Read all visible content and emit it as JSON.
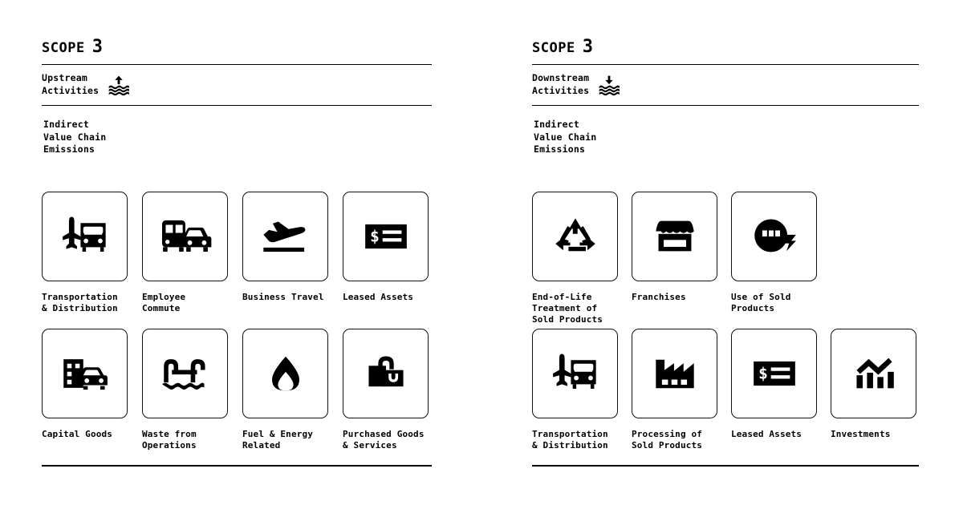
{
  "panels": [
    {
      "id": "upstream",
      "scope_word": "SCOPE",
      "scope_number": "3",
      "stream_label": "Upstream\nActivities",
      "stream_icon": "arrow-up-over-waves-icon",
      "emissions_note": "Indirect\nValue Chain\nEmissions",
      "rows": [
        {
          "cards": [
            {
              "label": "Transportation\n& Distribution",
              "icon": "plane-truck-icon"
            },
            {
              "label": "Employee\nCommute",
              "icon": "bus-car-icon"
            },
            {
              "label": "Business Travel",
              "icon": "plane-takeoff-icon"
            },
            {
              "label": "Leased Assets",
              "icon": "dollar-card-icon"
            }
          ]
        },
        {
          "cards": [
            {
              "label": "Capital Goods",
              "icon": "building-car-icon"
            },
            {
              "label": "Waste from\nOperations",
              "icon": "waste-water-icon"
            },
            {
              "label": "Fuel & Energy\nRelated",
              "icon": "droplet-icon"
            },
            {
              "label": "Purchased Goods\n& Services",
              "icon": "shopping-bag-icon"
            }
          ]
        }
      ]
    },
    {
      "id": "downstream",
      "scope_word": "SCOPE",
      "scope_number": "3",
      "stream_label": "Downstream\nActivities",
      "stream_icon": "arrow-down-over-waves-icon",
      "emissions_note": "Indirect\nValue Chain\nEmissions",
      "rows": [
        {
          "cards": [
            {
              "label": "End-of-Life\nTreatment of\nSold Products",
              "icon": "recycle-icon"
            },
            {
              "label": "Franchises",
              "icon": "storefront-icon"
            },
            {
              "label": "Use of Sold\nProducts",
              "icon": "appliance-bolt-icon"
            }
          ]
        },
        {
          "cards": [
            {
              "label": "Transportation\n& Distribution",
              "icon": "plane-truck-icon"
            },
            {
              "label": "Processing of\nSold Products",
              "icon": "factory-icon"
            },
            {
              "label": "Leased Assets",
              "icon": "dollar-card-icon"
            },
            {
              "label": "Investments",
              "icon": "growth-chart-icon"
            }
          ]
        }
      ]
    }
  ],
  "colors": {
    "ink": "#000000",
    "background": "#ffffff",
    "card_border": "#111111"
  }
}
